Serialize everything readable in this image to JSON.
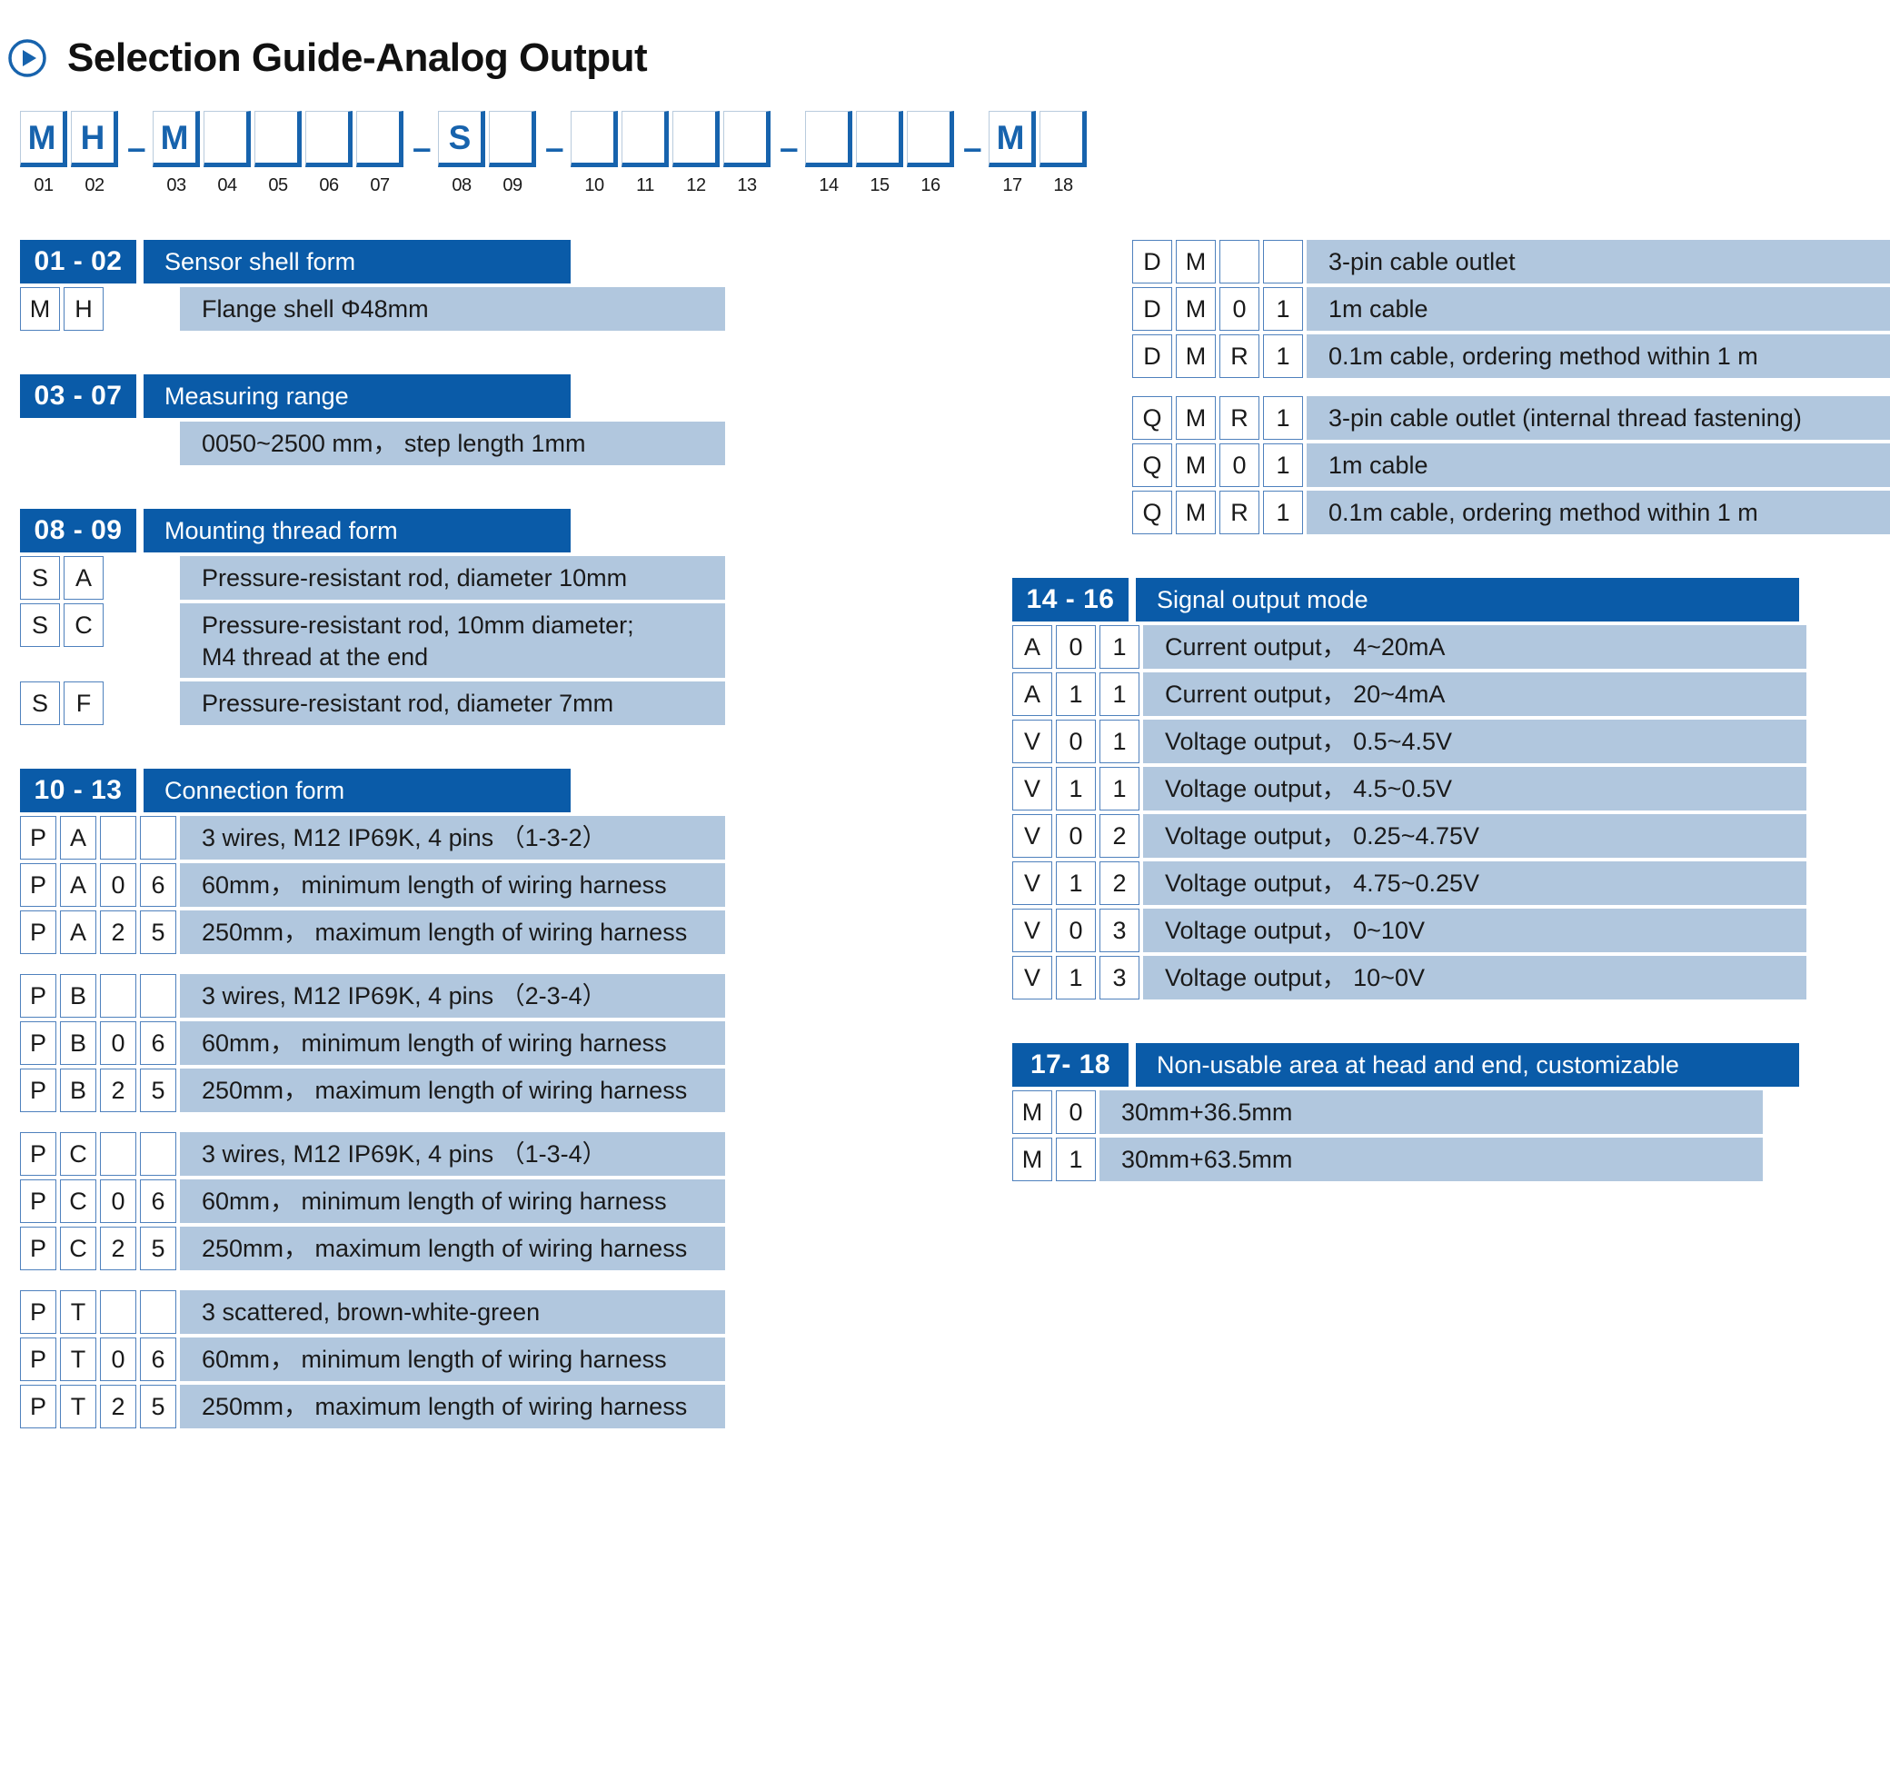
{
  "page": {
    "title": "Selection Guide-Analog Output",
    "accent_blue": "#0a5ba8",
    "row_fill": "#b1c7de",
    "box_border": "#4f81bd"
  },
  "code_string": {
    "dash_glyph": "–",
    "positions": [
      {
        "num": "01",
        "value": "M"
      },
      {
        "num": "02",
        "value": "H"
      },
      {
        "num": "03",
        "value": "M"
      },
      {
        "num": "04",
        "value": ""
      },
      {
        "num": "05",
        "value": ""
      },
      {
        "num": "06",
        "value": ""
      },
      {
        "num": "07",
        "value": ""
      },
      {
        "num": "08",
        "value": "S"
      },
      {
        "num": "09",
        "value": ""
      },
      {
        "num": "10",
        "value": ""
      },
      {
        "num": "11",
        "value": ""
      },
      {
        "num": "12",
        "value": ""
      },
      {
        "num": "13",
        "value": ""
      },
      {
        "num": "14",
        "value": ""
      },
      {
        "num": "15",
        "value": ""
      },
      {
        "num": "16",
        "value": ""
      },
      {
        "num": "17",
        "value": "M"
      },
      {
        "num": "18",
        "value": ""
      }
    ]
  },
  "sections": {
    "shell": {
      "code_range": "01 - 02",
      "title": "Sensor shell form",
      "rows": [
        {
          "codes": [
            "M",
            "H"
          ],
          "desc": "Flange shell Φ48mm"
        }
      ]
    },
    "range": {
      "code_range": "03 - 07",
      "title": "Measuring range",
      "rows": [
        {
          "codes": [],
          "desc": "0050~2500 mm， step length 1mm"
        }
      ]
    },
    "thread": {
      "code_range": "08 - 09",
      "title": "Mounting thread form",
      "rows": [
        {
          "codes": [
            "S",
            "A"
          ],
          "desc": "Pressure-resistant rod, diameter 10mm"
        },
        {
          "codes": [
            "S",
            "C"
          ],
          "desc": "Pressure-resistant rod, 10mm diameter;\nM4 thread at the end"
        },
        {
          "codes": [
            "S",
            "F"
          ],
          "desc": "Pressure-resistant rod, diameter 7mm"
        }
      ]
    },
    "connection": {
      "code_range": "10 - 13",
      "title": "Connection form",
      "rows_left": [
        {
          "codes": [
            "P",
            "A",
            "",
            ""
          ],
          "desc": "3 wires, M12 IP69K, 4 pins （1-3-2）"
        },
        {
          "codes": [
            "P",
            "A",
            "0",
            "6"
          ],
          "desc": "60mm， minimum length of wiring harness"
        },
        {
          "codes": [
            "P",
            "A",
            "2",
            "5"
          ],
          "desc": "250mm， maximum length of wiring harness"
        },
        {
          "codes": [
            "P",
            "B",
            "",
            ""
          ],
          "desc": "3 wires, M12 IP69K, 4 pins （2-3-4）"
        },
        {
          "codes": [
            "P",
            "B",
            "0",
            "6"
          ],
          "desc": "60mm， minimum length of wiring harness"
        },
        {
          "codes": [
            "P",
            "B",
            "2",
            "5"
          ],
          "desc": "250mm， maximum length of wiring harness"
        },
        {
          "codes": [
            "P",
            "C",
            "",
            ""
          ],
          "desc": "3 wires, M12 IP69K, 4 pins （1-3-4）"
        },
        {
          "codes": [
            "P",
            "C",
            "0",
            "6"
          ],
          "desc": "60mm， minimum length of wiring harness"
        },
        {
          "codes": [
            "P",
            "C",
            "2",
            "5"
          ],
          "desc": "250mm， maximum length of wiring harness"
        },
        {
          "codes": [
            "P",
            "T",
            "",
            ""
          ],
          "desc": "3 scattered, brown-white-green"
        },
        {
          "codes": [
            "P",
            "T",
            "0",
            "6"
          ],
          "desc": "60mm， minimum length of wiring harness"
        },
        {
          "codes": [
            "P",
            "T",
            "2",
            "5"
          ],
          "desc": "250mm， maximum length of wiring harness"
        }
      ],
      "rows_right_group1": [
        {
          "codes": [
            "D",
            "M",
            "",
            ""
          ],
          "desc": "3-pin cable outlet"
        },
        {
          "codes": [
            "D",
            "M",
            "0",
            "1"
          ],
          "desc": "1m cable"
        },
        {
          "codes": [
            "D",
            "M",
            "R",
            "1"
          ],
          "desc": "0.1m cable, ordering method within 1 m"
        }
      ],
      "rows_right_group2": [
        {
          "codes": [
            "Q",
            "M",
            "R",
            "1"
          ],
          "desc": "3-pin cable outlet (internal thread fastening)"
        },
        {
          "codes": [
            "Q",
            "M",
            "0",
            "1"
          ],
          "desc": "1m cable"
        },
        {
          "codes": [
            "Q",
            "M",
            "R",
            "1"
          ],
          "desc": "0.1m cable, ordering method within 1 m"
        }
      ]
    },
    "signal": {
      "code_range": "14 - 16",
      "title": "Signal output mode",
      "rows": [
        {
          "codes": [
            "A",
            "0",
            "1"
          ],
          "desc": "Current output， 4~20mA"
        },
        {
          "codes": [
            "A",
            "1",
            "1"
          ],
          "desc": "Current output， 20~4mA"
        },
        {
          "codes": [
            "V",
            "0",
            "1"
          ],
          "desc": "Voltage output， 0.5~4.5V"
        },
        {
          "codes": [
            "V",
            "1",
            "1"
          ],
          "desc": "Voltage output， 4.5~0.5V"
        },
        {
          "codes": [
            "V",
            "0",
            "2"
          ],
          "desc": "Voltage output， 0.25~4.75V"
        },
        {
          "codes": [
            "V",
            "1",
            "2"
          ],
          "desc": "Voltage output， 4.75~0.25V"
        },
        {
          "codes": [
            "V",
            "0",
            "3"
          ],
          "desc": "Voltage output， 0~10V"
        },
        {
          "codes": [
            "V",
            "1",
            "3"
          ],
          "desc": "Voltage output， 10~0V"
        }
      ]
    },
    "nonusable": {
      "code_range": "17- 18",
      "title": "Non-usable area at head and end, customizable",
      "rows": [
        {
          "codes": [
            "M",
            "0"
          ],
          "desc": "30mm+36.5mm"
        },
        {
          "codes": [
            "M",
            "1"
          ],
          "desc": "30mm+63.5mm"
        }
      ]
    }
  }
}
